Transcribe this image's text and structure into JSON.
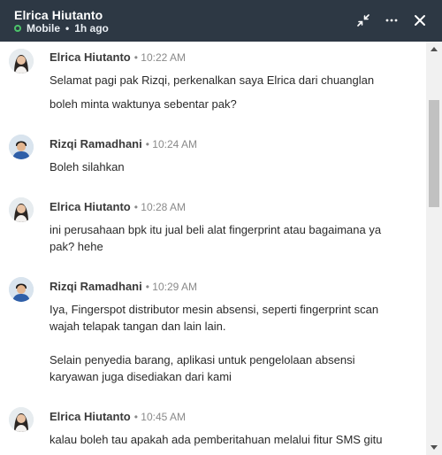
{
  "window": {
    "contact_name": "Elrica Hiutanto",
    "status_device": "Mobile",
    "status_separator": "•",
    "status_time": "1h ago",
    "status_color": "#4cc36a",
    "header_bg": "#2d3844",
    "icons": {
      "collapse": "collapse-arrows-icon",
      "more": "more-horizontal-icon",
      "close": "close-icon"
    }
  },
  "messages": [
    {
      "sender": "Elrica Hiutanto",
      "time": "• 10:22 AM",
      "avatar": "female-avatar",
      "lines": [
        "Selamat pagi pak Rizqi, perkenalkan saya Elrica dari chuanglan",
        "boleh minta waktunya sebentar pak?"
      ]
    },
    {
      "sender": "Rizqi Ramadhani",
      "time": "• 10:24 AM",
      "avatar": "male-avatar",
      "lines": [
        "Boleh silahkan"
      ]
    },
    {
      "sender": "Elrica Hiutanto",
      "time": "• 10:28 AM",
      "avatar": "female-avatar",
      "lines": [
        "ini perusahaan bpk itu jual beli alat fingerprint atau bagaimana ya",
        "pak? hehe"
      ]
    },
    {
      "sender": "Rizqi Ramadhani",
      "time": "• 10:29 AM",
      "avatar": "male-avatar",
      "lines": [
        "Iya, Fingerspot distributor mesin absensi, seperti fingerprint scan",
        "wajah telapak tangan dan lain lain.",
        "Selain penyedia barang, aplikasi untuk pengelolaan absensi",
        "karyawan juga disediakan dari kami"
      ]
    },
    {
      "sender": "Elrica Hiutanto",
      "time": "• 10:45 AM",
      "avatar": "female-avatar",
      "lines": [
        "kalau boleh tau apakah ada pemberitahuan melalui fitur SMS gitu"
      ]
    }
  ],
  "scrollbar": {
    "up_icon": "scroll-up-arrow-icon",
    "down_icon": "scroll-down-arrow-icon"
  }
}
